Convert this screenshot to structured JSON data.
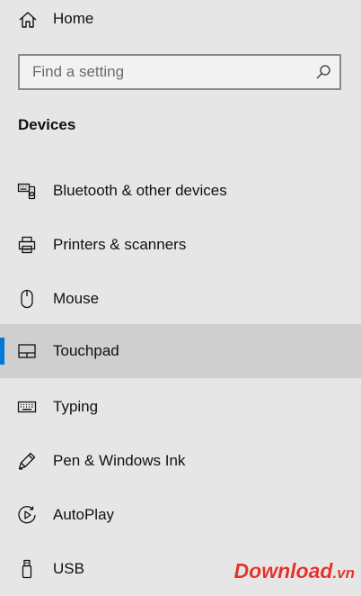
{
  "colors": {
    "background": "#e6e6e6",
    "selected_background": "#cfcfcf",
    "accent": "#0078d7",
    "text": "#111111"
  },
  "home": {
    "label": "Home",
    "icon": "home-icon"
  },
  "search": {
    "placeholder": "Find a setting",
    "value": "",
    "icon": "search-icon"
  },
  "section_title": "Devices",
  "nav": [
    {
      "label": "Bluetooth & other devices",
      "icon": "bluetooth-devices-icon",
      "selected": false
    },
    {
      "label": "Printers & scanners",
      "icon": "printer-icon",
      "selected": false
    },
    {
      "label": "Mouse",
      "icon": "mouse-icon",
      "selected": false
    },
    {
      "label": "Touchpad",
      "icon": "touchpad-icon",
      "selected": true
    },
    {
      "label": "Typing",
      "icon": "keyboard-icon",
      "selected": false
    },
    {
      "label": "Pen & Windows Ink",
      "icon": "pen-icon",
      "selected": false
    },
    {
      "label": "AutoPlay",
      "icon": "autoplay-icon",
      "selected": false
    },
    {
      "label": "USB",
      "icon": "usb-icon",
      "selected": false
    }
  ],
  "watermark": {
    "text": "Download.vn"
  }
}
